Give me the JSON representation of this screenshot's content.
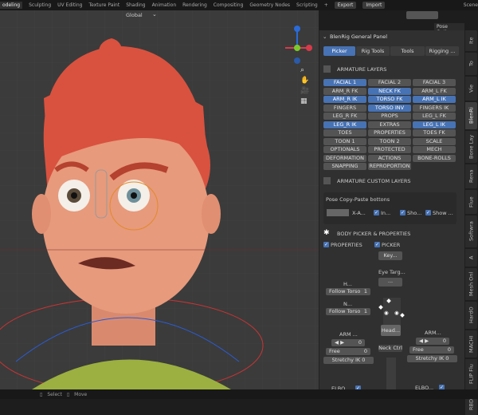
{
  "topbar": {
    "workspaces": [
      "odeling",
      "Sculpting",
      "UV Editing",
      "Texture Paint",
      "Shading",
      "Animation",
      "Rendering",
      "Compositing",
      "Geometry Nodes",
      "Scripting"
    ],
    "add": "+",
    "export": "Export",
    "import": "Import",
    "scene": "Scene"
  },
  "viewport_header": {
    "orientation": "Global",
    "pose_options": "Pose Options",
    "gizmo": {
      "z": "Z",
      "y": "Y",
      "x": "X"
    }
  },
  "panel": {
    "title": "BlenRig General Panel",
    "tabs": [
      "Picker",
      "Rig Tools",
      "Tools",
      "Rigging ..."
    ],
    "armature_layers_title": "ARMATURE LAYERS",
    "layers": [
      {
        "label": "FACIAL 1",
        "on": true
      },
      {
        "label": "FACIAL 2",
        "on": false
      },
      {
        "label": "FACIAL 3",
        "on": false
      },
      {
        "label": "ARM_R FK",
        "on": false
      },
      {
        "label": "NECK FK",
        "on": true
      },
      {
        "label": "ARM_L FK",
        "on": false
      },
      {
        "label": "ARM_R IK",
        "on": true
      },
      {
        "label": "TORSO FK",
        "on": true
      },
      {
        "label": "ARM_L IK",
        "on": true
      },
      {
        "label": "FINGERS",
        "on": false
      },
      {
        "label": "TORSO INV",
        "on": true
      },
      {
        "label": "FINGERS IK",
        "on": false
      },
      {
        "label": "LEG_R FK",
        "on": false
      },
      {
        "label": "PROPS",
        "on": false
      },
      {
        "label": "LEG_L FK",
        "on": false
      },
      {
        "label": "LEG_R IK",
        "on": true
      },
      {
        "label": "EXTRAS",
        "on": false
      },
      {
        "label": "LEG_L IK",
        "on": true
      },
      {
        "label": "TOES",
        "on": false
      },
      {
        "label": "PROPERTIES",
        "on": false
      },
      {
        "label": "TOES FK",
        "on": false
      },
      {
        "label": "TOON 1",
        "on": false
      },
      {
        "label": "TOON 2",
        "on": false
      },
      {
        "label": "SCALE",
        "on": false
      },
      {
        "label": "OPTIONALS",
        "on": false
      },
      {
        "label": "PROTECTED",
        "on": false
      },
      {
        "label": "MECH",
        "on": false
      },
      {
        "label": "DEFORMATION",
        "on": false
      },
      {
        "label": "ACTIONS",
        "on": false
      },
      {
        "label": "BONE-ROLLS",
        "on": false
      },
      {
        "label": "SNAPPING",
        "on": false
      },
      {
        "label": "REPROPORTION",
        "on": false
      }
    ],
    "custom_layers_title": "ARMATURE CUSTOM LAYERS",
    "pose_copy": {
      "title": "Pose Copy-Paste bottons",
      "x_axis": "X-A...",
      "opts": [
        "In...",
        "Sho...",
        "Show ..."
      ]
    },
    "body_picker_title": "BODY PICKER & PROPERTIES",
    "properties_label": "PROPERTIES",
    "picker_label": "PICKER",
    "key_label": "Key...",
    "eye_target": "Eye Targ...",
    "eye_btn": "...",
    "head_label": "H...",
    "neck_label": "N...",
    "follow_torso": "Follow Torso",
    "follow_value": "1",
    "head_btn": "Head...",
    "neck_ctrl": "Neck Ctrl",
    "arm": {
      "label": "ARM ...",
      "value": "0",
      "free": "Free",
      "free_value": "0",
      "stretchy": "Stretchy IK 0"
    },
    "arm_r": {
      "label": "ARM...",
      "value": "0",
      "free": "Free",
      "free_value": "0",
      "stretchy": "Stretchy IK 0"
    },
    "elbow": "ELBO..."
  },
  "side_tabs": [
    "Ite",
    "To",
    "Vie",
    "BlenRi",
    "Bone Lay",
    "Rena",
    "Flue",
    "Softwra",
    "A",
    "Mesh Onl",
    "HardO",
    "MACHI",
    "FLIP Flu",
    "RBDL"
  ],
  "status": {
    "select": "Select",
    "move": "Move"
  }
}
